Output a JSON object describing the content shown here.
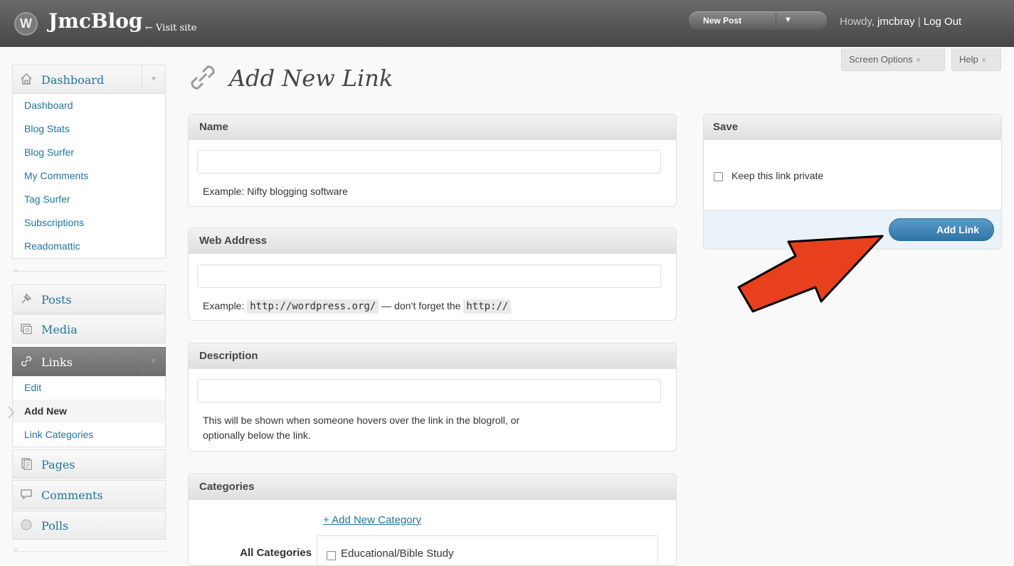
{
  "header": {
    "logo_glyph": "W",
    "site_title": "JmcBlog",
    "visit_site": "← Visit site",
    "new_post": "New Post",
    "new_post_caret": "▼",
    "howdy_prefix": "Howdy,",
    "username": "jmcbray",
    "separator": "|",
    "logout": "Log Out"
  },
  "screen_meta": {
    "screen_options": "Screen Options",
    "help": "Help",
    "caret": "▼"
  },
  "sidebar": {
    "dashboard": {
      "label": "Dashboard",
      "items": [
        "Dashboard",
        "Blog Stats",
        "Blog Surfer",
        "My Comments",
        "Tag Surfer",
        "Subscriptions",
        "Readomattic"
      ]
    },
    "menu": {
      "posts": "Posts",
      "media": "Media",
      "links": "Links",
      "pages": "Pages",
      "comments": "Comments",
      "polls": "Polls"
    },
    "links_sub": [
      "Edit",
      "Add New",
      "Link Categories"
    ],
    "collapse_glyph": "«",
    "toggle_glyph": "▼",
    "icons": {
      "dashboard": "home-icon",
      "posts": "pushpin-icon",
      "media": "media-icon",
      "links": "link-icon",
      "pages": "pages-icon",
      "comments": "comment-icon",
      "polls": "polls-icon"
    }
  },
  "page": {
    "title": "Add New Link",
    "icon": "link-icon"
  },
  "name_box": {
    "title": "Name",
    "value": "",
    "hint": "Example: Nifty blogging software"
  },
  "web_address_box": {
    "title": "Web Address",
    "value": "",
    "hint_prefix": "Example:",
    "hint_code1": "http://wordpress.org/",
    "hint_mid": "— don’t forget the",
    "hint_code2": "http://"
  },
  "description_box": {
    "title": "Description",
    "value": "",
    "hint_line1": "This will be shown when someone hovers over the link in the blogroll, or",
    "hint_line2": "optionally below the link."
  },
  "categories_box": {
    "title": "Categories",
    "add_new": "+ Add New Category",
    "tab_all": "All Categories",
    "items": [
      "Educational/Bible Study"
    ]
  },
  "save_box": {
    "title": "Save",
    "private_label": "Keep this link private",
    "private_checked": false,
    "add_link": "Add Link"
  },
  "annotation": {
    "arrow_color": "#e8401c"
  }
}
